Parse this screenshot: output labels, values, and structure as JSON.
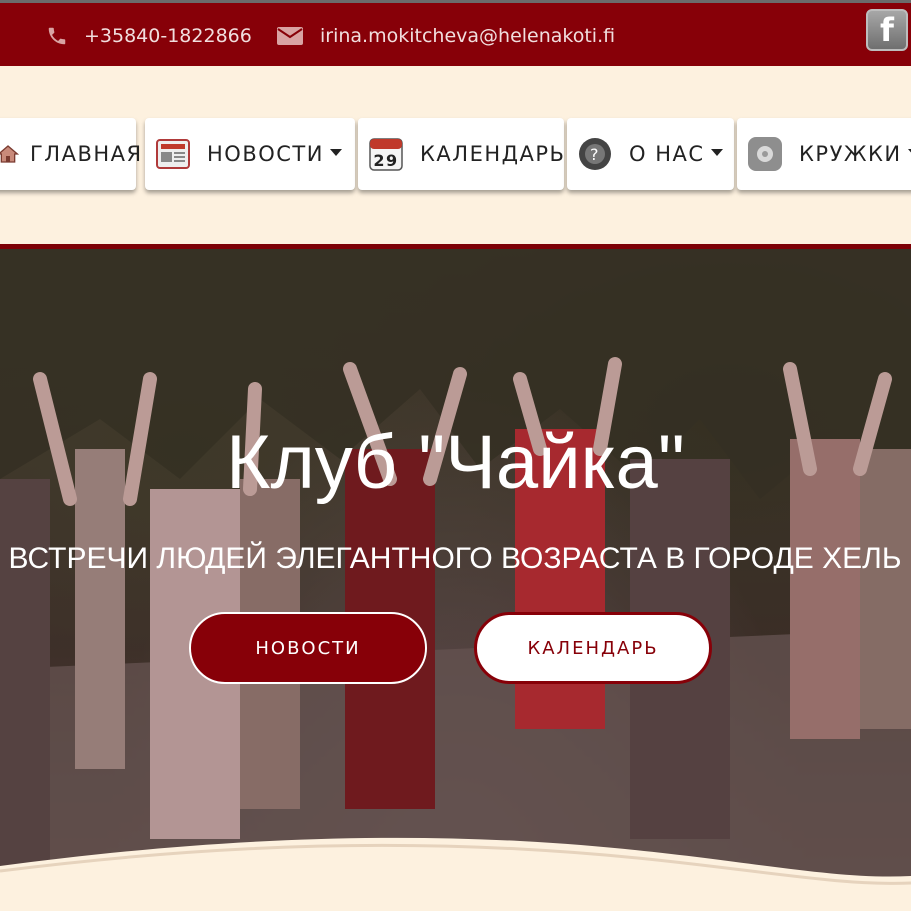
{
  "colors": {
    "brand": "#870008",
    "cream": "#fdf1df"
  },
  "topbar": {
    "phone_icon": "phone-icon",
    "phone": "+35840-1822866",
    "mail_icon": "envelope-icon",
    "email": "irina.mokitcheva@helenakoti.fi",
    "facebook_icon": "facebook-icon",
    "facebook_glyph": "f"
  },
  "nav": {
    "items": [
      {
        "label": "ГЛАВНАЯ",
        "icon": "home-icon"
      },
      {
        "label": "НОВОСТИ",
        "icon": "newspaper-icon",
        "dropdown": true
      },
      {
        "label": "КАЛЕНДАРЬ",
        "icon": "calendar-icon",
        "calendar_day": "29"
      },
      {
        "label": "О НАС",
        "icon": "info-icon",
        "dropdown": true
      },
      {
        "label": "КРУЖКИ",
        "icon": "circle-icon",
        "dropdown": true
      }
    ]
  },
  "hero": {
    "title": "Клуб \"Чайка\"",
    "subtitle": "ВСТРЕЧИ ЛЮДЕЙ ЭЛЕГАНТНОГО ВОЗРАСТА В ГОРОДЕ ХЕЛЬ",
    "buttons": {
      "news": "НОВОСТИ",
      "calendar": "КАЛЕНДАРЬ"
    }
  }
}
